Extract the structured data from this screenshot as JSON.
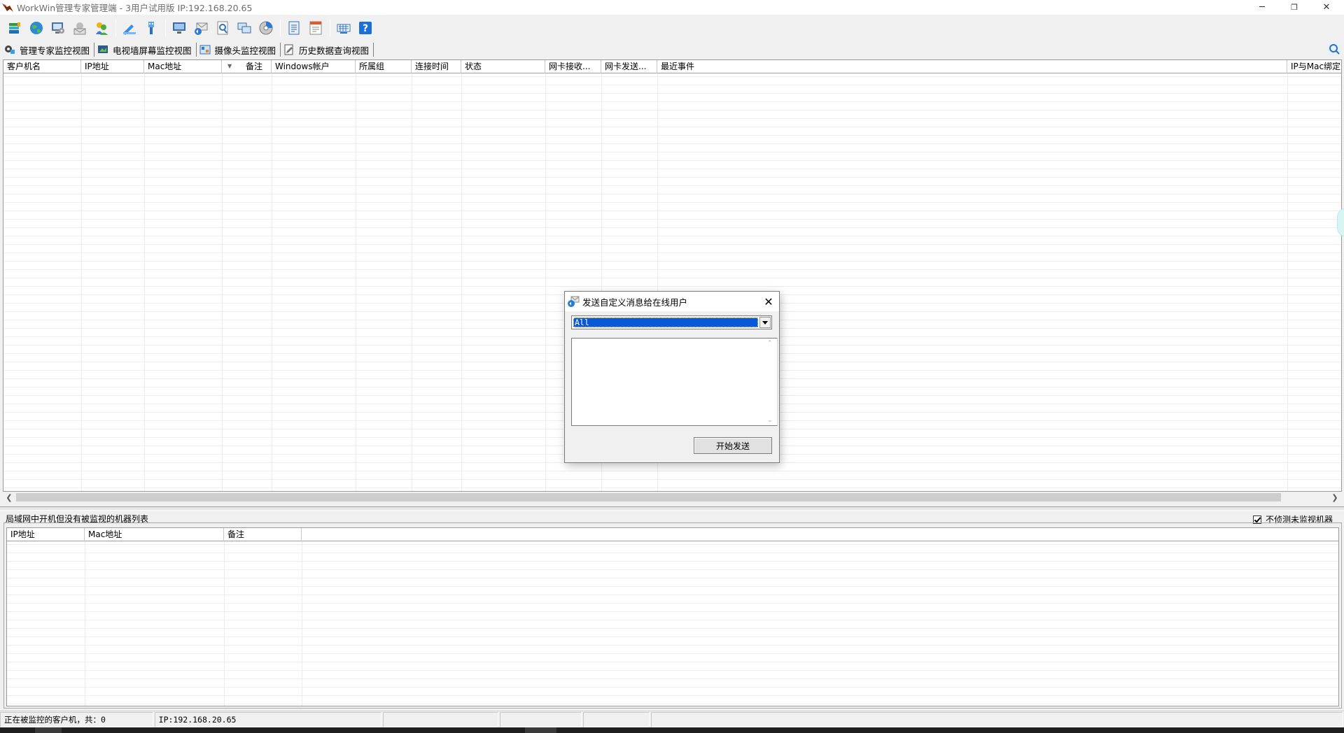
{
  "window": {
    "title": "WorkWin管理专家管理端 - 3用户试用版 IP:192.168.20.65",
    "minimize": "─",
    "restore": "❐",
    "close": "✕"
  },
  "toolbar": {
    "groups": [
      [
        "green-books-icon",
        "globe-icon",
        "monitor-settings-icon",
        "mail-icon",
        "users-icon"
      ],
      [
        "pencil-edit-icon",
        "usb-icon"
      ],
      [
        "screen-icon",
        "mail-send-icon",
        "magnifier-doc-icon",
        "windows-icon",
        "disk-icon"
      ],
      [
        "doc-list-icon",
        "doc-report-icon"
      ],
      [
        "keyboard-icon",
        "help-icon"
      ]
    ]
  },
  "views": {
    "tabs": [
      {
        "label": "管理专家监控视图",
        "icon": "monitor-view-icon"
      },
      {
        "label": "电视墙屏幕监控视图",
        "icon": "tv-wall-icon"
      },
      {
        "label": "摄像头监控视图",
        "icon": "camera-icon"
      },
      {
        "label": "历史数据查询视图",
        "icon": "history-doc-icon"
      }
    ]
  },
  "main_grid": {
    "columns": [
      "客户机名",
      "IP地址",
      "Mac地址",
      "备注",
      "Windows帐户",
      "所属组",
      "连接时间",
      "状态",
      "网卡接收...",
      "网卡发送...",
      "最近事件",
      "IP与Mac绑定"
    ],
    "rows": []
  },
  "lower_panel": {
    "label": "局域网中开机但没有被监视的机器列表",
    "checkbox_label": "不侦测未监视机器",
    "checkbox_checked": true,
    "columns": [
      "IP地址",
      "Mac地址",
      "备注"
    ],
    "rows": []
  },
  "status_bar": {
    "monitored": "正在被监控的客户机，共：0",
    "ip": "IP:192.168.20.65"
  },
  "dialog": {
    "title": "发送自定义消息给在线用户",
    "target_selected": "All",
    "message_value": "",
    "send_label": "开始发送",
    "close": "✕"
  }
}
